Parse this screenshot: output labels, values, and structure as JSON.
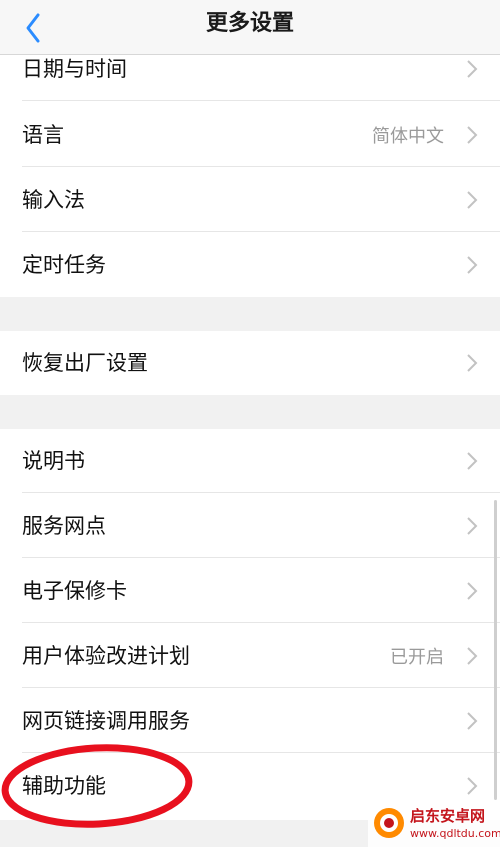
{
  "header": {
    "title": "更多设置",
    "back_icon": "chevron-left-icon"
  },
  "colors": {
    "accent": "#2b8cff",
    "annotation": "#e8101e",
    "value_text": "#9a9a9a",
    "chevron": "#c2c2c2"
  },
  "groups": [
    {
      "items": [
        {
          "label": "日期与时间",
          "value": ""
        },
        {
          "label": "语言",
          "value": "简体中文"
        },
        {
          "label": "输入法",
          "value": ""
        },
        {
          "label": "定时任务",
          "value": ""
        }
      ]
    },
    {
      "items": [
        {
          "label": "恢复出厂设置",
          "value": ""
        }
      ]
    },
    {
      "items": [
        {
          "label": "说明书",
          "value": ""
        },
        {
          "label": "服务网点",
          "value": ""
        },
        {
          "label": "电子保修卡",
          "value": ""
        },
        {
          "label": "用户体验改进计划",
          "value": "已开启"
        },
        {
          "label": "网页链接调用服务",
          "value": ""
        },
        {
          "label": "辅助功能",
          "value": ""
        }
      ]
    }
  ],
  "watermark": {
    "name": "启东安卓网",
    "url": "www.qdltdu.com"
  }
}
